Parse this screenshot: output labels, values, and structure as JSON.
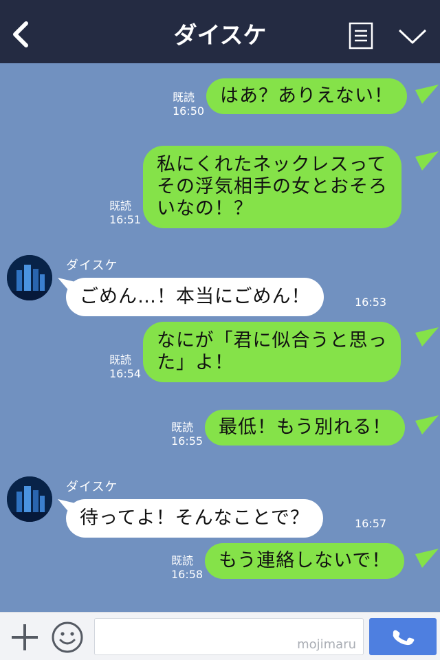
{
  "header": {
    "title": "ダイスケ",
    "icons": {
      "back": "chevron-left-icon",
      "menu": "document-menu-icon",
      "collapse": "chevron-down-icon"
    }
  },
  "contact": {
    "name": "ダイスケ"
  },
  "messages": [
    {
      "side": "me",
      "text": [
        "はあ？ありえない！"
      ],
      "read": "既読",
      "time": "16:50"
    },
    {
      "side": "me",
      "text": [
        "私にくれたネックレスって",
        "その浮気相手の女とおそろ",
        "いなの！？"
      ],
      "read": "既読",
      "time": "16:51"
    },
    {
      "side": "them",
      "sender": "ダイスケ",
      "text": [
        "ごめん…！本当にごめん！"
      ],
      "time": "16:53"
    },
    {
      "side": "me",
      "text": [
        "なにが「君に似合うと思っ",
        "た」よ！"
      ],
      "read": "既読",
      "time": "16:54"
    },
    {
      "side": "me",
      "text": [
        "最低！もう別れる！"
      ],
      "read": "既読",
      "time": "16:55"
    },
    {
      "side": "them",
      "sender": "ダイスケ",
      "text": [
        "待ってよ！そんなことで？"
      ],
      "time": "16:57"
    },
    {
      "side": "me",
      "text": [
        "もう連絡しないで！"
      ],
      "read": "既読",
      "time": "16:58"
    }
  ],
  "footer": {
    "watermark": "mojimaru",
    "icons": {
      "add": "plus-icon",
      "emoji": "smiley-icon",
      "call": "phone-icon"
    }
  },
  "colors": {
    "header": "#242b42",
    "chat_bg": "#7191c0",
    "my_bubble": "#85e249",
    "their_bubble": "#ffffff",
    "call_button": "#4e7fe0"
  }
}
